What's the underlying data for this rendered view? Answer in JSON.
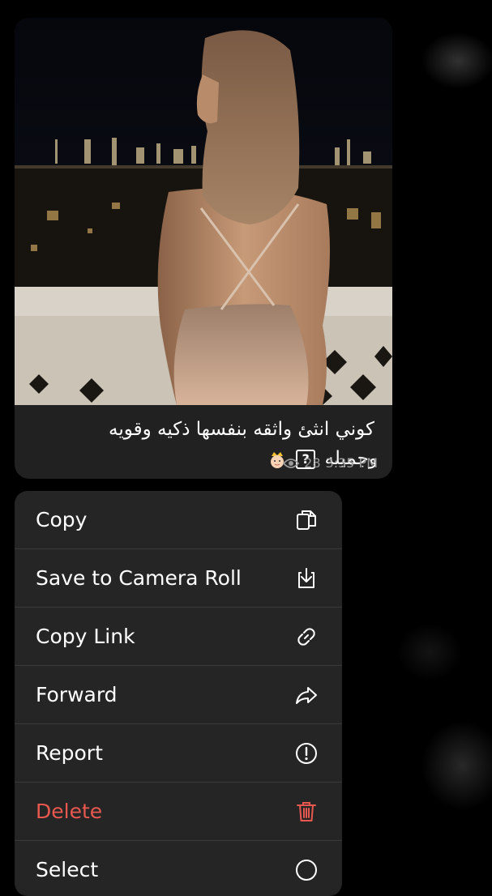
{
  "message": {
    "caption_line1": "كوني انثئ واثقه بنفسها ذكيه وقويه",
    "caption_line2": "وجميله",
    "caption_symbol": "?",
    "views": "28",
    "time": "3:35 PM"
  },
  "menu": {
    "items": [
      {
        "label": "Copy",
        "icon": "copy-icon"
      },
      {
        "label": "Save to Camera Roll",
        "icon": "save-download-icon"
      },
      {
        "label": "Copy Link",
        "icon": "link-icon"
      },
      {
        "label": "Forward",
        "icon": "forward-icon"
      },
      {
        "label": "Report",
        "icon": "report-exclamation-icon"
      },
      {
        "label": "Delete",
        "icon": "trash-icon"
      },
      {
        "label": "Select",
        "icon": "select-circle-icon"
      }
    ]
  },
  "colors": {
    "background": "#000000",
    "bubble": "#212121",
    "menu": "#252525",
    "danger": "#e8584f",
    "meta": "#9a9a9a"
  }
}
